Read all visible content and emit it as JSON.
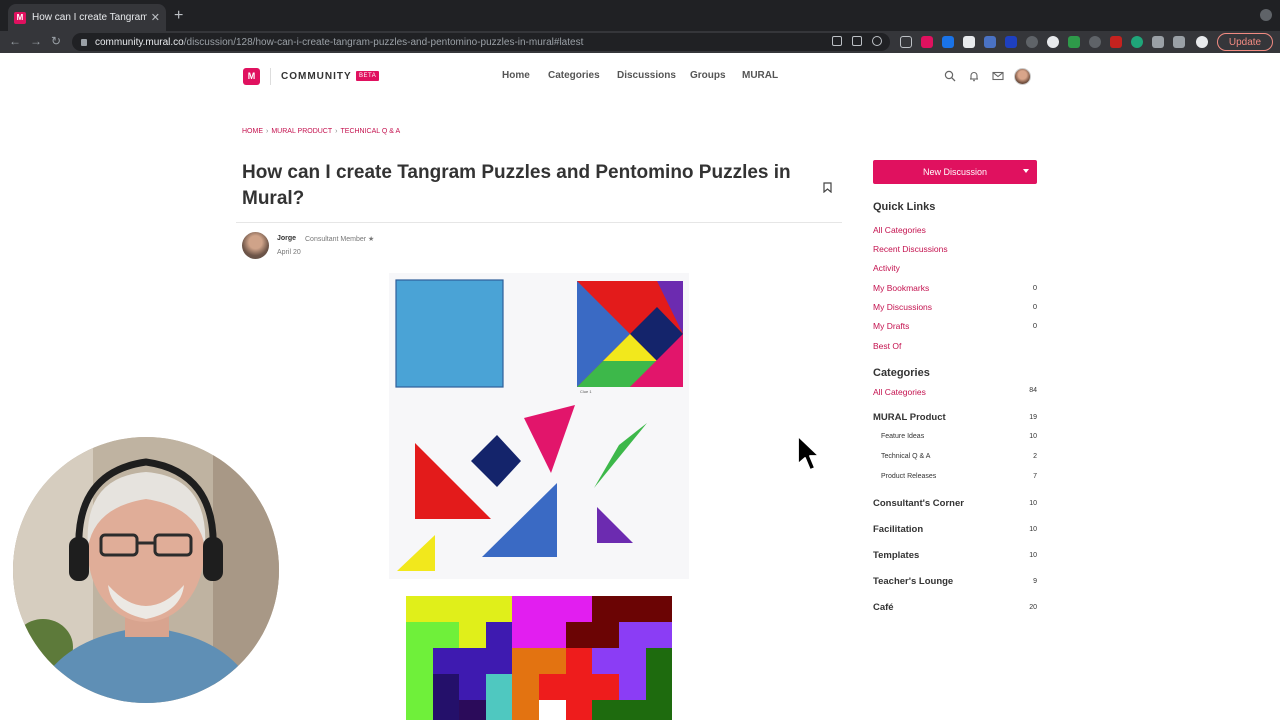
{
  "browser": {
    "tab_title": "How can I create Tangram Puz…",
    "tab_favicon": "M",
    "url_host": "community.mural.co",
    "url_path": "/discussion/128/how-can-i-create-tangram-puzzles-and-pentomino-puzzles-in-mural#latest",
    "update_label": "Update"
  },
  "header": {
    "logo_letter": "M",
    "community_label": "COMMUNITY",
    "beta_label": "BETA",
    "nav": [
      "Home",
      "Categories",
      "Discussions",
      "Groups",
      "MURAL"
    ]
  },
  "breadcrumb": [
    "HOME",
    "MURAL PRODUCT",
    "TECHNICAL Q & A"
  ],
  "post": {
    "title": "How can I create Tangram Puzzles and Pentomino Puzzles in Mural?",
    "author": "Jorge",
    "roles": "Consultant   Member   ★",
    "date": "April 20",
    "image_caption": "Clue 1"
  },
  "sidebar": {
    "new_discussion_label": "New Discussion",
    "quick_links_title": "Quick Links",
    "quick_links": [
      {
        "label": "All Categories",
        "count": ""
      },
      {
        "label": "Recent Discussions",
        "count": ""
      },
      {
        "label": "Activity",
        "count": ""
      },
      {
        "label": "My Bookmarks",
        "count": "0"
      },
      {
        "label": "My Discussions",
        "count": "0"
      },
      {
        "label": "My Drafts",
        "count": "0"
      },
      {
        "label": "Best Of",
        "count": ""
      }
    ],
    "categories_title": "Categories",
    "all_categories": {
      "label": "All Categories",
      "count": "84"
    },
    "mural_product": {
      "label": "MURAL Product",
      "count": "19"
    },
    "subcategories": [
      {
        "label": "Feature Ideas",
        "count": "10"
      },
      {
        "label": "Technical Q & A",
        "count": "2"
      },
      {
        "label": "Product Releases",
        "count": "7"
      }
    ],
    "categories": [
      {
        "label": "Consultant's Corner",
        "count": "10"
      },
      {
        "label": "Facilitation",
        "count": "10"
      },
      {
        "label": "Templates",
        "count": "10"
      },
      {
        "label": "Teacher's Lounge",
        "count": "9"
      },
      {
        "label": "Café",
        "count": "20"
      }
    ]
  },
  "colors": {
    "accent": "#e0115f",
    "link": "#c4124f",
    "tangram_blue": "#4aa3d6",
    "tangram_red": "#e31b1b",
    "tangram_navy": "#14246b",
    "tangram_pink": "#e2156b",
    "tangram_green": "#3db84a",
    "tangram_purple": "#6c2bb0",
    "tangram_yellow": "#f2e81c",
    "tangram_mid_blue": "#3a6ac4"
  }
}
